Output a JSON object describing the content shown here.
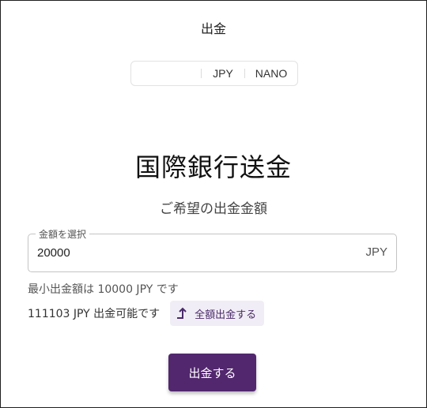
{
  "page": {
    "title": "出金"
  },
  "currency_toggle": {
    "options": [
      "",
      "JPY",
      "NANO"
    ],
    "selected": "JPY"
  },
  "main": {
    "heading": "国際銀行送金",
    "subheading": "ご希望の出金金額"
  },
  "amount_field": {
    "label": "金額を選択",
    "value": "20000",
    "unit": "JPY"
  },
  "notes": {
    "minimum": "最小出金額は 10000 JPY です",
    "available": "111103 JPY 出金可能です"
  },
  "buttons": {
    "withdraw_all": "全額出金する",
    "submit": "出金する"
  },
  "colors": {
    "accent": "#52276e",
    "accent_light": "#f1edf6"
  },
  "icons": {
    "withdraw_all": "arrow-up-corner-icon"
  }
}
